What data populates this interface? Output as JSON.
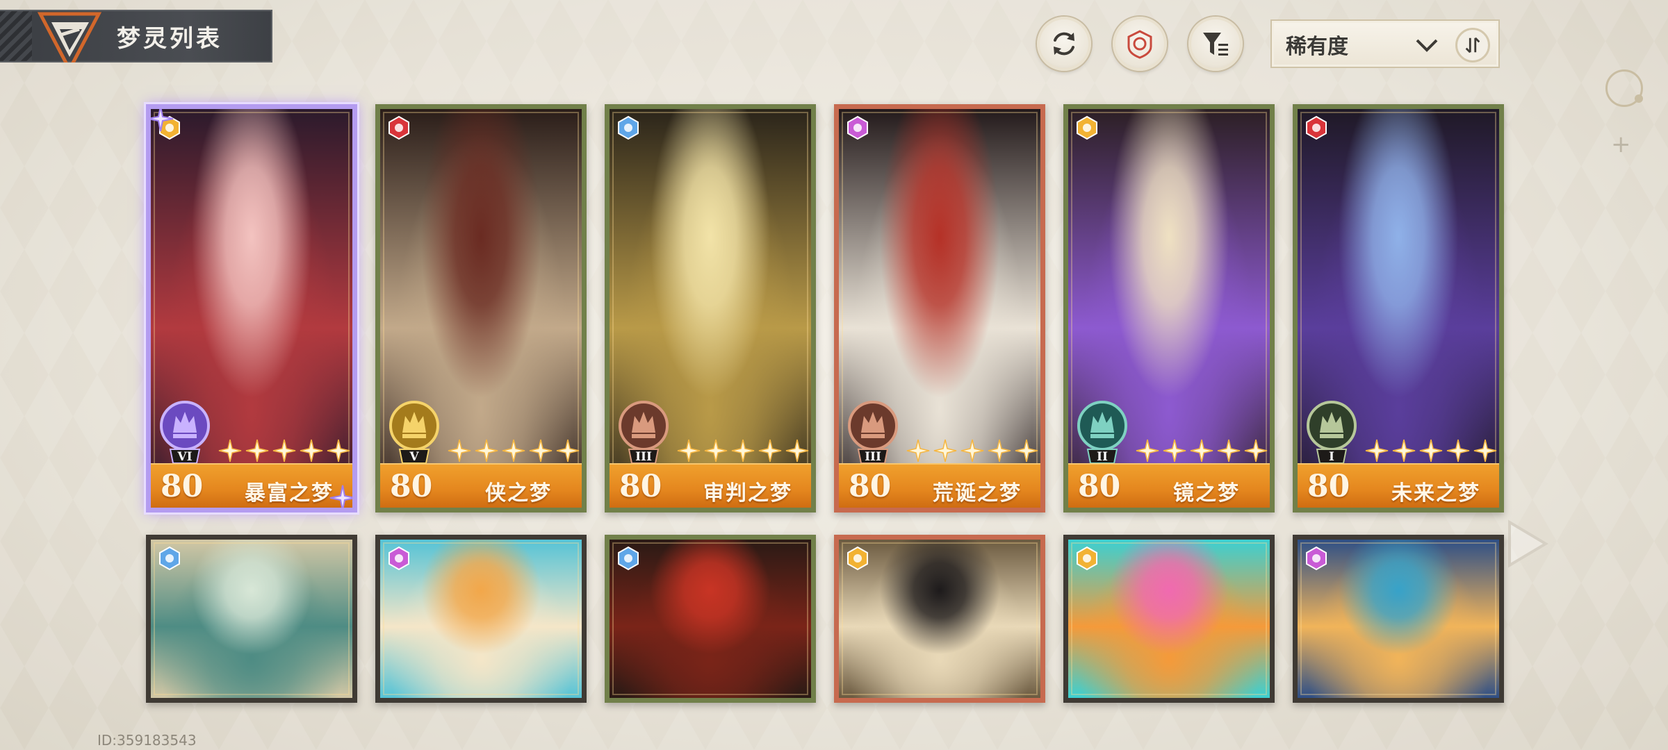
{
  "header": {
    "title": "梦灵列表"
  },
  "toolbar": {
    "sort": {
      "label": "稀有度"
    },
    "buttons": [
      {
        "name": "refresh-icon"
      },
      {
        "name": "target-icon"
      },
      {
        "name": "filter-icon"
      }
    ]
  },
  "cards": [
    {
      "level": "80",
      "name": "暴富之梦",
      "rank": "VI",
      "stars": 5,
      "frame": "selected",
      "element_color": "#f2b233",
      "bg": [
        "#f3c3c0",
        "#b23a3f",
        "#2b1a2c"
      ]
    },
    {
      "level": "80",
      "name": "侠之梦",
      "rank": "V",
      "stars": 5,
      "frame": "green",
      "element_color": "#d9343a",
      "bg": [
        "#6a2b22",
        "#c2a98a",
        "#2a1d19"
      ]
    },
    {
      "level": "80",
      "name": "审判之梦",
      "rank": "III",
      "stars": 5,
      "frame": "green",
      "element_color": "#5fa6e8",
      "bg": [
        "#f2e3a8",
        "#b99a48",
        "#2a241a"
      ]
    },
    {
      "level": "80",
      "name": "荒诞之梦",
      "rank": "III",
      "stars": 5,
      "frame": "red",
      "element_color": "#c95bd6",
      "bg": [
        "#b53127",
        "#e9e2d6",
        "#231a1b"
      ]
    },
    {
      "level": "80",
      "name": "镜之梦",
      "rank": "II",
      "stars": 5,
      "frame": "green",
      "element_color": "#f2b233",
      "bg": [
        "#efe1c2",
        "#8d5ad0",
        "#2c1f24"
      ]
    },
    {
      "level": "80",
      "name": "未来之梦",
      "rank": "I",
      "stars": 5,
      "frame": "green",
      "element_color": "#d9343a",
      "bg": [
        "#8fb1e8",
        "#5a3e9c",
        "#1f1926"
      ]
    },
    {
      "frame": "dark",
      "element_color": "#5fa6e8",
      "bg": [
        "#d8e7d7",
        "#4e8c84",
        "#d2c7a5"
      ]
    },
    {
      "frame": "dark",
      "element_color": "#c95bd6",
      "bg": [
        "#f2a74a",
        "#f5e6c8",
        "#55c3d6"
      ]
    },
    {
      "frame": "green",
      "element_color": "#5fa6e8",
      "bg": [
        "#c83424",
        "#7a2418",
        "#2a1a15"
      ]
    },
    {
      "frame": "red",
      "element_color": "#f2b233",
      "bg": [
        "#1d1a1b",
        "#e9d9b8",
        "#6b5a40"
      ]
    },
    {
      "frame": "dark",
      "element_color": "#f2b233",
      "bg": [
        "#f06ab0",
        "#f59a3a",
        "#3bd0d2"
      ]
    },
    {
      "frame": "dark",
      "element_color": "#c95bd6",
      "bg": [
        "#37a2c9",
        "#f1b45a",
        "#2e4f86"
      ]
    }
  ],
  "footer": {
    "player_id": "ID:359183543"
  }
}
